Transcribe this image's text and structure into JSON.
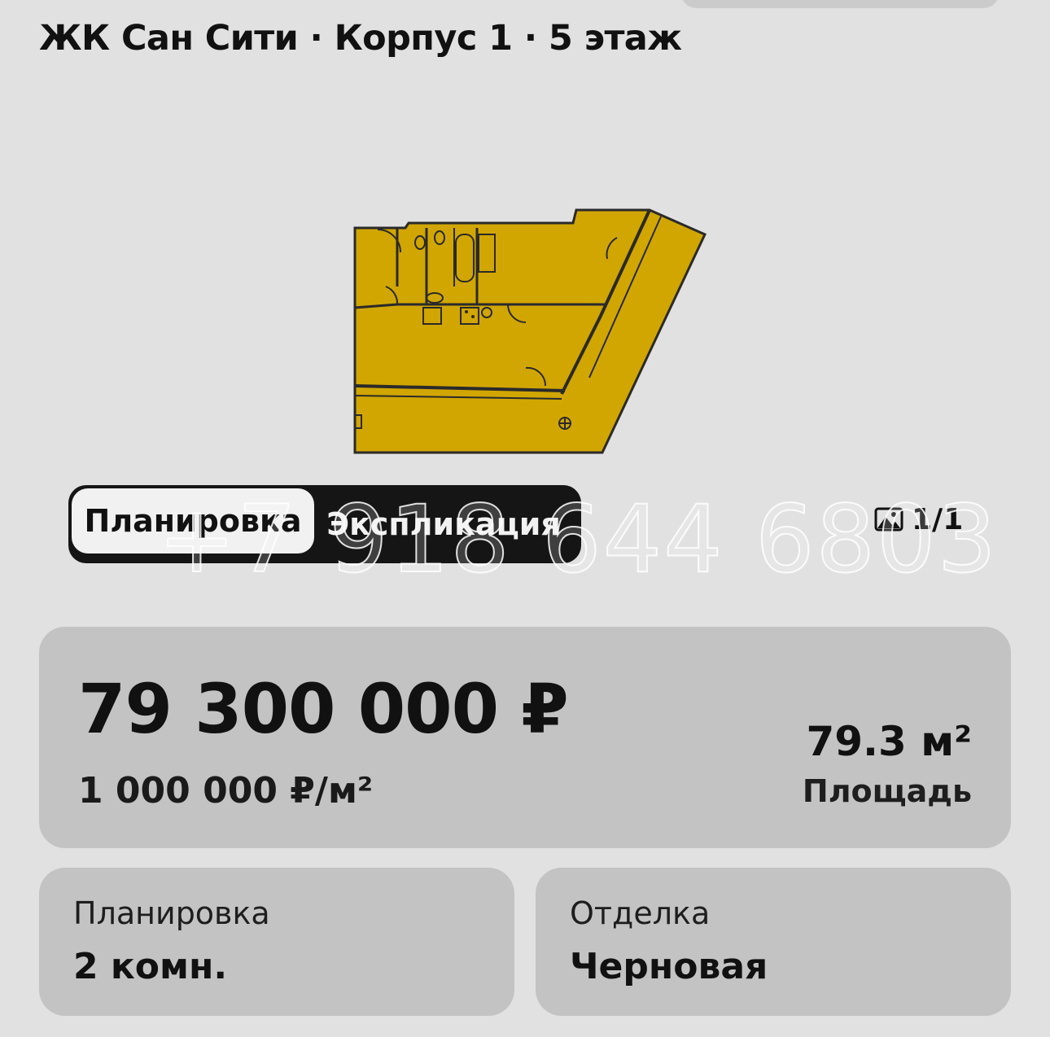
{
  "header": {
    "title": "ЖК Сан Сити · Корпус 1 · 5 этаж"
  },
  "floorplan": {
    "fill_color": "#d1a600",
    "wall_color": "#2a2a2a"
  },
  "tabs": [
    {
      "label": "Планировка",
      "active": true
    },
    {
      "label": "Экспликация",
      "active": false
    }
  ],
  "gallery": {
    "counter": "1/1",
    "icon": "image-icon"
  },
  "watermark": "+7 918 644 6803",
  "price": {
    "total": "79 300 000 ₽",
    "per_meter": "1 000 000 ₽/м²",
    "area_value": "79.3 м²",
    "area_label": "Площадь"
  },
  "details": [
    {
      "label": "Планировка",
      "value": "2 комн."
    },
    {
      "label": "Отделка",
      "value": "Черновая"
    }
  ],
  "colors": {
    "background": "#e1e1e1",
    "card": "#c3c3c3",
    "tab_bar": "#151515",
    "tab_active": "#f1f1f1"
  }
}
